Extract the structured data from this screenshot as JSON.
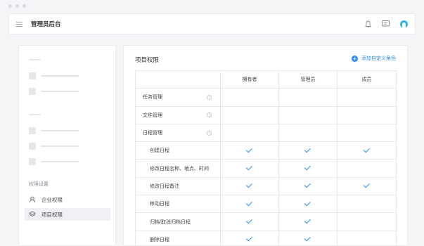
{
  "header": {
    "title": "管理员后台"
  },
  "icons": {
    "menu": "menu-icon",
    "bell": "bell-icon",
    "message": "message-icon",
    "avatar": "avatar-icon"
  },
  "sidebar": {
    "section_title": "权限设置",
    "items": [
      {
        "label": "企业权限",
        "icon": "enterprise-icon",
        "active": false
      },
      {
        "label": "项目权限",
        "icon": "layers-icon",
        "active": true
      }
    ]
  },
  "main": {
    "title": "项目权限",
    "add_role_label": "添加自定义角色",
    "accent": "#2f8ef4",
    "columns": [
      "拥有者",
      "管理员",
      "成员"
    ],
    "rows": [
      {
        "name": "任务管理",
        "group": true,
        "checks": [
          false,
          false,
          false
        ]
      },
      {
        "name": "文件管理",
        "group": true,
        "checks": [
          false,
          false,
          false
        ]
      },
      {
        "name": "日程管理",
        "group": true,
        "checks": [
          false,
          false,
          false
        ]
      },
      {
        "name": "创建日程",
        "group": false,
        "checks": [
          true,
          true,
          true
        ]
      },
      {
        "name": "修改日程名称、地点、时间",
        "group": false,
        "checks": [
          true,
          true,
          false
        ]
      },
      {
        "name": "修改日程备注",
        "group": false,
        "checks": [
          true,
          true,
          true
        ]
      },
      {
        "name": "移动日程",
        "group": false,
        "checks": [
          true,
          true,
          false
        ]
      },
      {
        "name": "归档/取消归档日程",
        "group": false,
        "checks": [
          true,
          true,
          false
        ]
      },
      {
        "name": "删除日程",
        "group": false,
        "checks": [
          true,
          true,
          false
        ]
      }
    ]
  }
}
